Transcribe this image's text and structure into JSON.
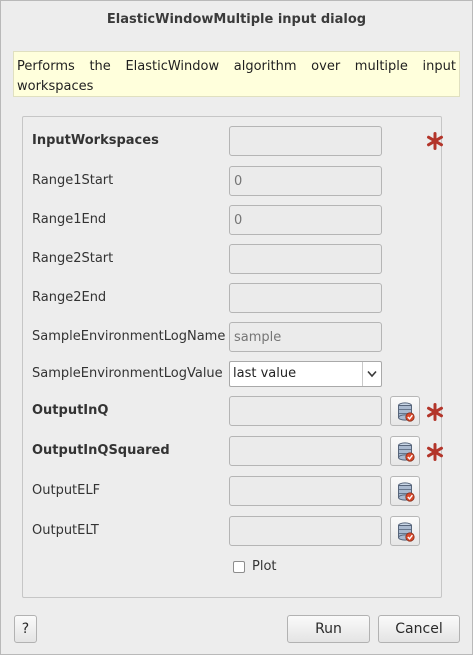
{
  "window": {
    "title": "ElasticWindowMultiple input dialog"
  },
  "description": "Performs the ElasticWindow algorithm over multiple input workspaces",
  "fields": {
    "input_workspaces": {
      "label": "InputWorkspaces",
      "value": ""
    },
    "range1_start": {
      "label": "Range1Start",
      "placeholder": "0"
    },
    "range1_end": {
      "label": "Range1End",
      "placeholder": "0"
    },
    "range2_start": {
      "label": "Range2Start",
      "value": ""
    },
    "range2_end": {
      "label": "Range2End",
      "value": ""
    },
    "sample_env_log_name": {
      "label": "SampleEnvironmentLogName",
      "placeholder": "sample"
    },
    "sample_env_log_value": {
      "label": "SampleEnvironmentLogValue",
      "selected": "last value"
    },
    "output_inq": {
      "label": "OutputInQ",
      "value": ""
    },
    "output_inq_squared": {
      "label": "OutputInQSquared",
      "value": ""
    },
    "output_elf": {
      "label": "OutputELF",
      "value": ""
    },
    "output_elt": {
      "label": "OutputELT",
      "value": ""
    }
  },
  "plot": {
    "label": "Plot",
    "checked": false
  },
  "buttons": {
    "help": "?",
    "run": "Run",
    "cancel": "Cancel"
  },
  "icons": {
    "mandatory": "asterisk-icon",
    "browse": "workspace-browse-icon"
  },
  "colors": {
    "mandatory_star": "#b3352a",
    "description_bg": "#ffffdc"
  }
}
